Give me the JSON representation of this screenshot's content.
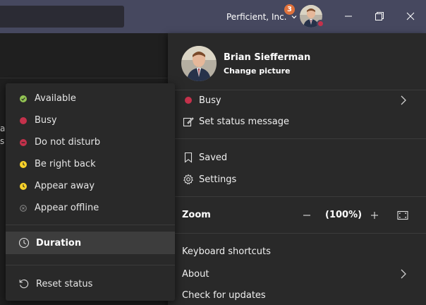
{
  "titlebar": {
    "org_name": "Perficient, Inc.",
    "notification_count": "3",
    "window_controls": [
      "minimize-icon",
      "restore-icon",
      "close-icon"
    ]
  },
  "background": {
    "fragments": [
      "ar",
      "s t"
    ]
  },
  "profile": {
    "name": "Brian Siefferman",
    "change_picture": "Change picture",
    "status_label": "Busy",
    "status_color": "#c4314b",
    "set_status_message": "Set status message",
    "saved": "Saved",
    "settings": "Settings",
    "zoom_label": "Zoom",
    "zoom_value": "(100%)",
    "keyboard_shortcuts": "Keyboard shortcuts",
    "about": "About",
    "check_updates": "Check for updates"
  },
  "status_menu": {
    "items": [
      {
        "label": "Available",
        "color": "#92c353",
        "icon": "check-icon"
      },
      {
        "label": "Busy",
        "color": "#c4314b",
        "icon": "dot-icon"
      },
      {
        "label": "Do not disturb",
        "color": "#c4314b",
        "icon": "minus-icon"
      },
      {
        "label": "Be right back",
        "color": "#f8d22a",
        "icon": "clock-icon"
      },
      {
        "label": "Appear away",
        "color": "#f8d22a",
        "icon": "clock-icon"
      },
      {
        "label": "Appear offline",
        "color": "#8a8a8a",
        "icon": "offline-icon"
      }
    ],
    "duration": "Duration",
    "reset_status": "Reset status"
  }
}
